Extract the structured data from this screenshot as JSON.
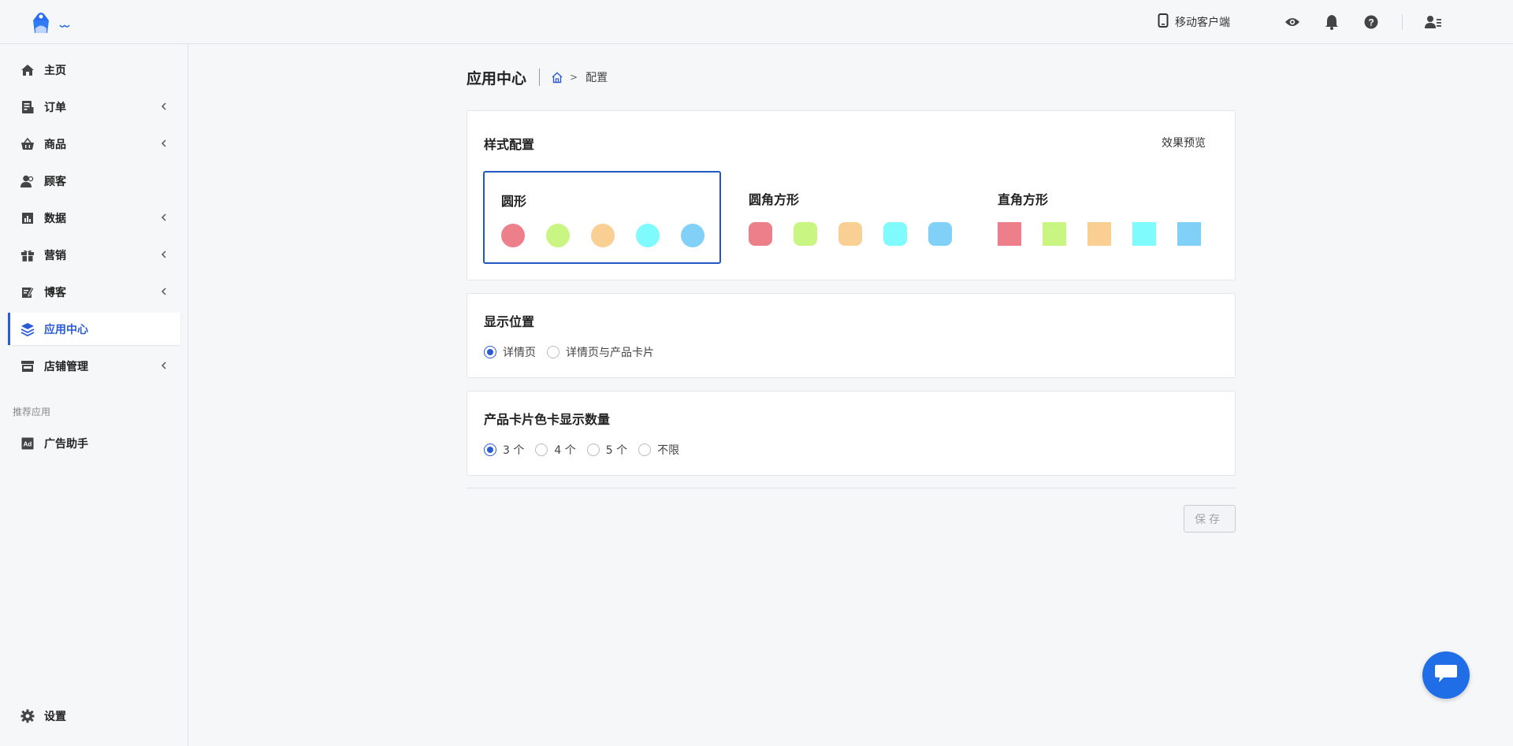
{
  "topbar": {
    "mobile_client_label": "移动客户端",
    "icons": [
      "eye-icon",
      "bell-icon",
      "help-icon",
      "user-menu-icon"
    ]
  },
  "sidebar": {
    "items": [
      {
        "label": "主页",
        "icon": "home-icon",
        "has_chevron": false
      },
      {
        "label": "订单",
        "icon": "order-icon",
        "has_chevron": true
      },
      {
        "label": "商品",
        "icon": "basket-icon",
        "has_chevron": true
      },
      {
        "label": "顾客",
        "icon": "customers-icon",
        "has_chevron": false
      },
      {
        "label": "数据",
        "icon": "chart-icon",
        "has_chevron": true
      },
      {
        "label": "营销",
        "icon": "gift-icon",
        "has_chevron": true
      },
      {
        "label": "博客",
        "icon": "blog-icon",
        "has_chevron": true
      },
      {
        "label": "应用中心",
        "icon": "layers-icon",
        "has_chevron": false,
        "active": true
      },
      {
        "label": "店铺管理",
        "icon": "store-icon",
        "has_chevron": true
      }
    ],
    "section_label": "推荐应用",
    "recommended": [
      {
        "label": "广告助手",
        "icon": "ad-icon"
      }
    ],
    "settings_label": "设置"
  },
  "header": {
    "title": "应用中心",
    "breadcrumb_current": "配置",
    "breadcrumb_separator": ">"
  },
  "style_config": {
    "title": "样式配置",
    "preview_label": "效果预览",
    "options": [
      {
        "label": "圆形",
        "shape": "circle",
        "selected": true
      },
      {
        "label": "圆角方形",
        "shape": "rounded",
        "selected": false
      },
      {
        "label": "直角方形",
        "shape": "square",
        "selected": false
      }
    ],
    "swatch_colors": [
      "#ed7f8a",
      "#c9f583",
      "#f9cf93",
      "#80fbfd",
      "#81d0f8"
    ]
  },
  "display_position": {
    "title": "显示位置",
    "options": [
      {
        "label": "详情页",
        "checked": true
      },
      {
        "label": "详情页与产品卡片",
        "checked": false
      }
    ]
  },
  "card_count": {
    "title": "产品卡片色卡显示数量",
    "options": [
      {
        "label": "3 个",
        "checked": true
      },
      {
        "label": "4 个",
        "checked": false
      },
      {
        "label": "5 个",
        "checked": false
      },
      {
        "label": "不限",
        "checked": false
      }
    ]
  },
  "actions": {
    "save_label": "保存"
  },
  "colors": {
    "accent": "#2a5bd7",
    "chat_button": "#1f6ee8"
  }
}
